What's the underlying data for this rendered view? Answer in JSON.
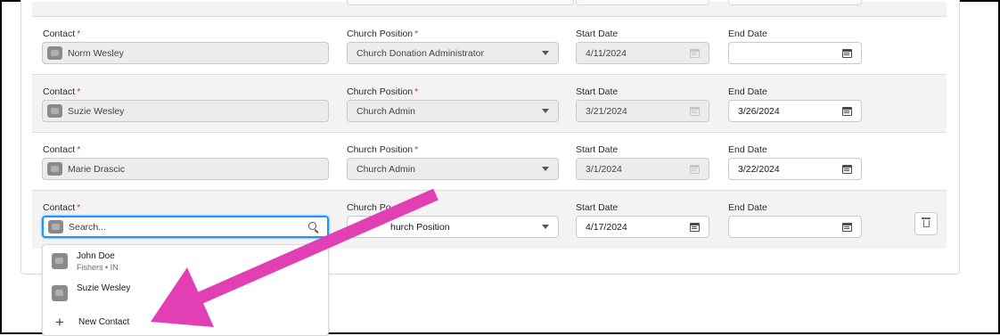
{
  "rows": [
    {
      "contact_label": "Contact",
      "contact_value": "Norm Wesley",
      "position_label": "Church Position",
      "position_value": "Church Donation Administrator",
      "start_label": "Start Date",
      "start_value": "4/11/2024",
      "end_label": "End Date",
      "end_value": ""
    },
    {
      "contact_label": "Contact",
      "contact_value": "Suzie Wesley",
      "position_label": "Church Position",
      "position_value": "Church Admin",
      "start_label": "Start Date",
      "start_value": "3/21/2024",
      "end_label": "End Date",
      "end_value": "3/26/2024"
    },
    {
      "contact_label": "Contact",
      "contact_value": "Marie Drascic",
      "position_label": "Church Position",
      "position_value": "Church Admin",
      "start_label": "Start Date",
      "start_value": "3/1/2024",
      "end_label": "End Date",
      "end_value": "3/22/2024"
    },
    {
      "contact_label": "Contact",
      "contact_placeholder": "Search...",
      "position_label": "Church Po",
      "position_value": "hurch Position",
      "start_label": "Start Date",
      "start_value": "4/17/2024",
      "end_label": "End Date",
      "end_value": ""
    }
  ],
  "required_marker": "*",
  "dropdown": {
    "options": [
      {
        "name": "John Doe",
        "meta": "Fishers • IN"
      },
      {
        "name": "Suzie Wesley",
        "meta": ""
      }
    ],
    "new_contact_label": "New Contact",
    "new_contact_icon": "+"
  },
  "icons": {
    "contact": "contact-avatar-icon",
    "dropdown": "chevron-down-icon",
    "date": "calendar-icon",
    "search": "search-icon",
    "delete": "trash-icon",
    "annotation": "arrow-annotation"
  },
  "colors": {
    "accent": "#1b96ff",
    "required": "#c23934",
    "annotation_arrow": "#e33fb5",
    "row_shade": "#f3f3f3"
  }
}
